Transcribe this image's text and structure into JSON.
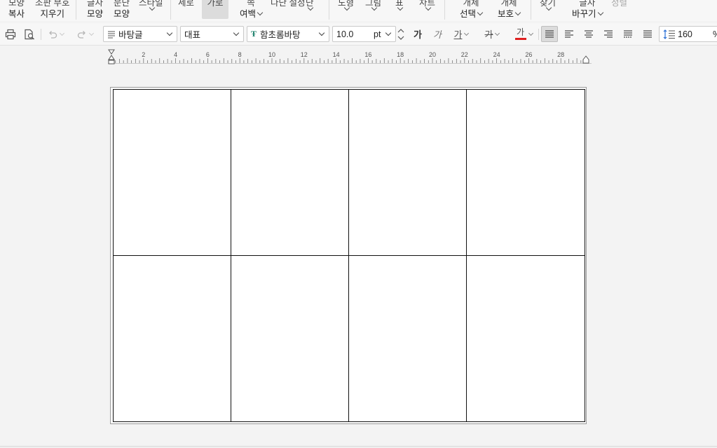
{
  "ribbon": {
    "groups": [
      {
        "top": "모양",
        "bottom": "복사",
        "chevron": false
      },
      {
        "top": "조판 부호",
        "bottom": "지우기",
        "chevron": false
      },
      {
        "top": "글자",
        "bottom": "모양",
        "chevron": false
      },
      {
        "top": "문단",
        "bottom": "모양",
        "chevron": false
      },
      {
        "top": "스타일",
        "bottom": "",
        "chevron": true
      },
      {
        "top": "세로",
        "bottom": "",
        "chevron": false
      },
      {
        "top": "가로",
        "bottom": "",
        "chevron": false,
        "active": true
      },
      {
        "top": "쪽",
        "bottom": "여백",
        "chevron": true
      },
      {
        "top": "다단 설정",
        "bottom": "",
        "chevron": false
      },
      {
        "top": "단",
        "bottom": "",
        "chevron": true
      },
      {
        "top": "도형",
        "bottom": "",
        "chevron": true
      },
      {
        "top": "그림",
        "bottom": "",
        "chevron": true
      },
      {
        "top": "표",
        "bottom": "",
        "chevron": true
      },
      {
        "top": "차트",
        "bottom": "",
        "chevron": true
      },
      {
        "top": "개체",
        "bottom": "선택",
        "chevron": true
      },
      {
        "top": "개체",
        "bottom": "보호",
        "chevron": true
      },
      {
        "top": "찾기",
        "bottom": "",
        "chevron": true
      },
      {
        "top": "글자",
        "bottom": "바꾸기",
        "chevron": true
      },
      {
        "top": "정렬",
        "bottom": "",
        "chevron": false
      }
    ]
  },
  "toolbar": {
    "style_value": "바탕글",
    "language_value": "대표",
    "font_value": "함초롬바탕",
    "font_size_value": "10.0",
    "font_size_unit": "pt",
    "bold_label": "가",
    "italic_label": "가",
    "underline_label": "가",
    "strike_label": "가",
    "color_label": "가",
    "line_spacing_value": "160",
    "line_spacing_unit": "%",
    "font_color": "#e02020"
  },
  "ruler": {
    "labels": [
      "2",
      "4",
      "6",
      "8",
      "10",
      "12",
      "14",
      "16",
      "18",
      "20",
      "22",
      "24",
      "26",
      "28"
    ]
  },
  "table": {
    "rows": 2,
    "cols": 4,
    "cells": [
      "",
      "",
      "",
      "",
      "",
      "",
      "",
      ""
    ]
  }
}
